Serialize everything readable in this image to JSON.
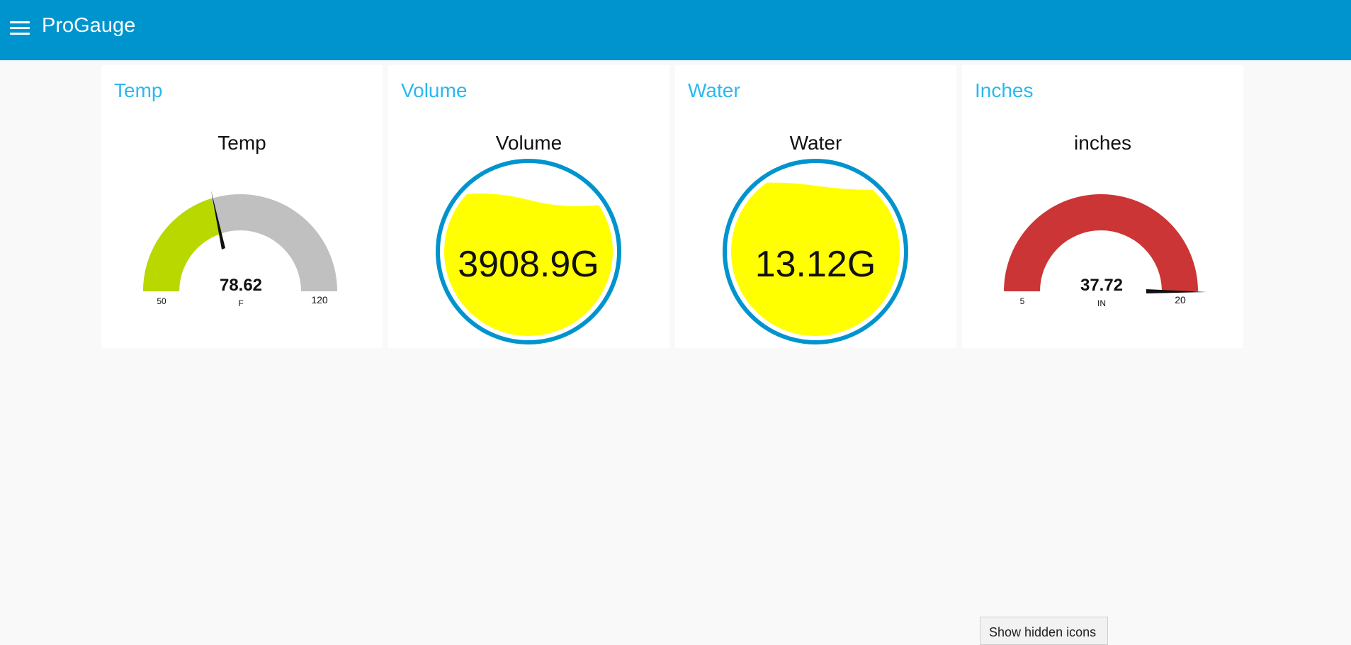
{
  "app": {
    "title": "ProGauge"
  },
  "header": {
    "menu_icon": "hamburger-menu-icon"
  },
  "cards": [
    {
      "title": "Temp",
      "label": "Temp",
      "type": "gauge",
      "value": "78.62",
      "units": "F",
      "min": "50",
      "max": "120",
      "color": "#b8d800"
    },
    {
      "title": "Volume",
      "label": "Volume",
      "type": "level",
      "value": "3908.9G",
      "fill_fraction": 0.76,
      "color": "#ffff00"
    },
    {
      "title": "Water",
      "label": "Water",
      "type": "level",
      "value": "13.12G",
      "fill_fraction": 0.84,
      "color": "#ffff00"
    },
    {
      "title": "Inches",
      "label": "inches",
      "type": "gauge",
      "value": "37.72",
      "units": "IN",
      "min": "5",
      "max": "20",
      "color": "#cc3535"
    }
  ],
  "system": {
    "hidden_icons_tooltip": "Show hidden icons"
  }
}
